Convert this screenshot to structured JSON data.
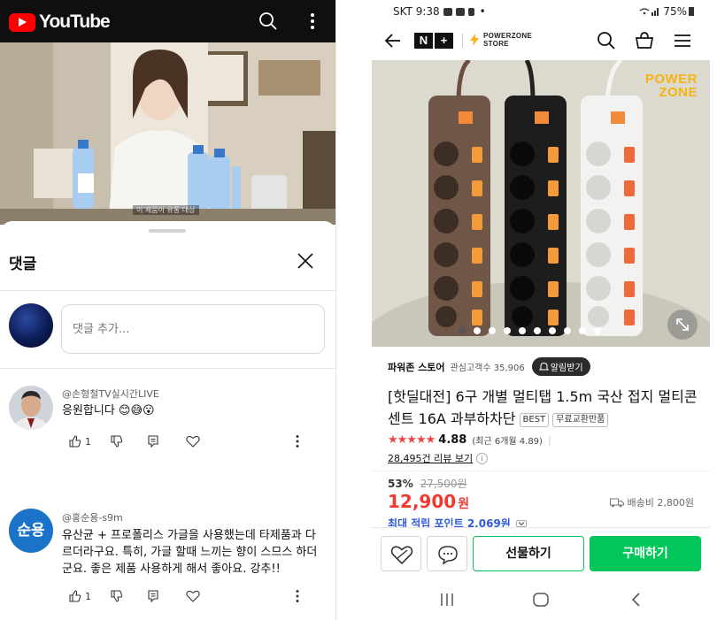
{
  "youtube": {
    "brand": "YouTube",
    "video_caption": "이 제품이 유통 대상",
    "comments_panel": {
      "title": "댓글",
      "add_placeholder": "댓글 추가..."
    },
    "comments": [
      {
        "author": "@손형철TV실시간LIVE",
        "text": "응원합니다 😊😅😮",
        "likes": "1"
      },
      {
        "author": "@홍순용-s9m",
        "avatar_text": "순용",
        "text": "유산균 + 프로폴리스 가글을 사용했는데 타제품과 다르더라구요. 특히, 가글 할때 느끼는 향이 스므스 하더군요. 좋은 제품 사용하게 해서 좋아요. 강추!!",
        "likes": "1"
      }
    ],
    "colors": {
      "brand_red": "#ff0000",
      "topbar": "#0f0f0f",
      "avatar_blue": "#1a73c8"
    }
  },
  "shop": {
    "status_bar": {
      "carrier_time": "SKT 9:38",
      "battery": "75%"
    },
    "brand_logo": "N+",
    "store_logo_text": "POWERZONE STORE",
    "product_image_brand": "POWER ZONE",
    "store": {
      "name": "파워존 스토어",
      "followers_label": "관심고객수 35,906",
      "alarm_button": "알림받기"
    },
    "product": {
      "title": "[핫딜대전] 6구 개별 멀티탭 1.5m 국산 접지 멀티콘센트 16A 과부하차단",
      "badges": [
        "BEST",
        "무료교환반품"
      ],
      "stars": "★★★★★",
      "rating": "4.88",
      "recent_rating": "(최근 6개월 4.89)",
      "reviews": "28,495건 리뷰 보기",
      "discount": "53%",
      "original_price": "27,500원",
      "price": "12,900",
      "currency": "원",
      "shipping": "배송비 2,800원",
      "points": "최대 적립 포인트 2,069원"
    },
    "image_page": {
      "current": 1,
      "total": 10
    },
    "buttons": {
      "gift": "선물하기",
      "buy": "구매하기"
    },
    "colors": {
      "naver_green": "#03c75a",
      "price_red": "#f0392f",
      "points_blue": "#2f5ad8",
      "stars": "#f04646"
    }
  }
}
